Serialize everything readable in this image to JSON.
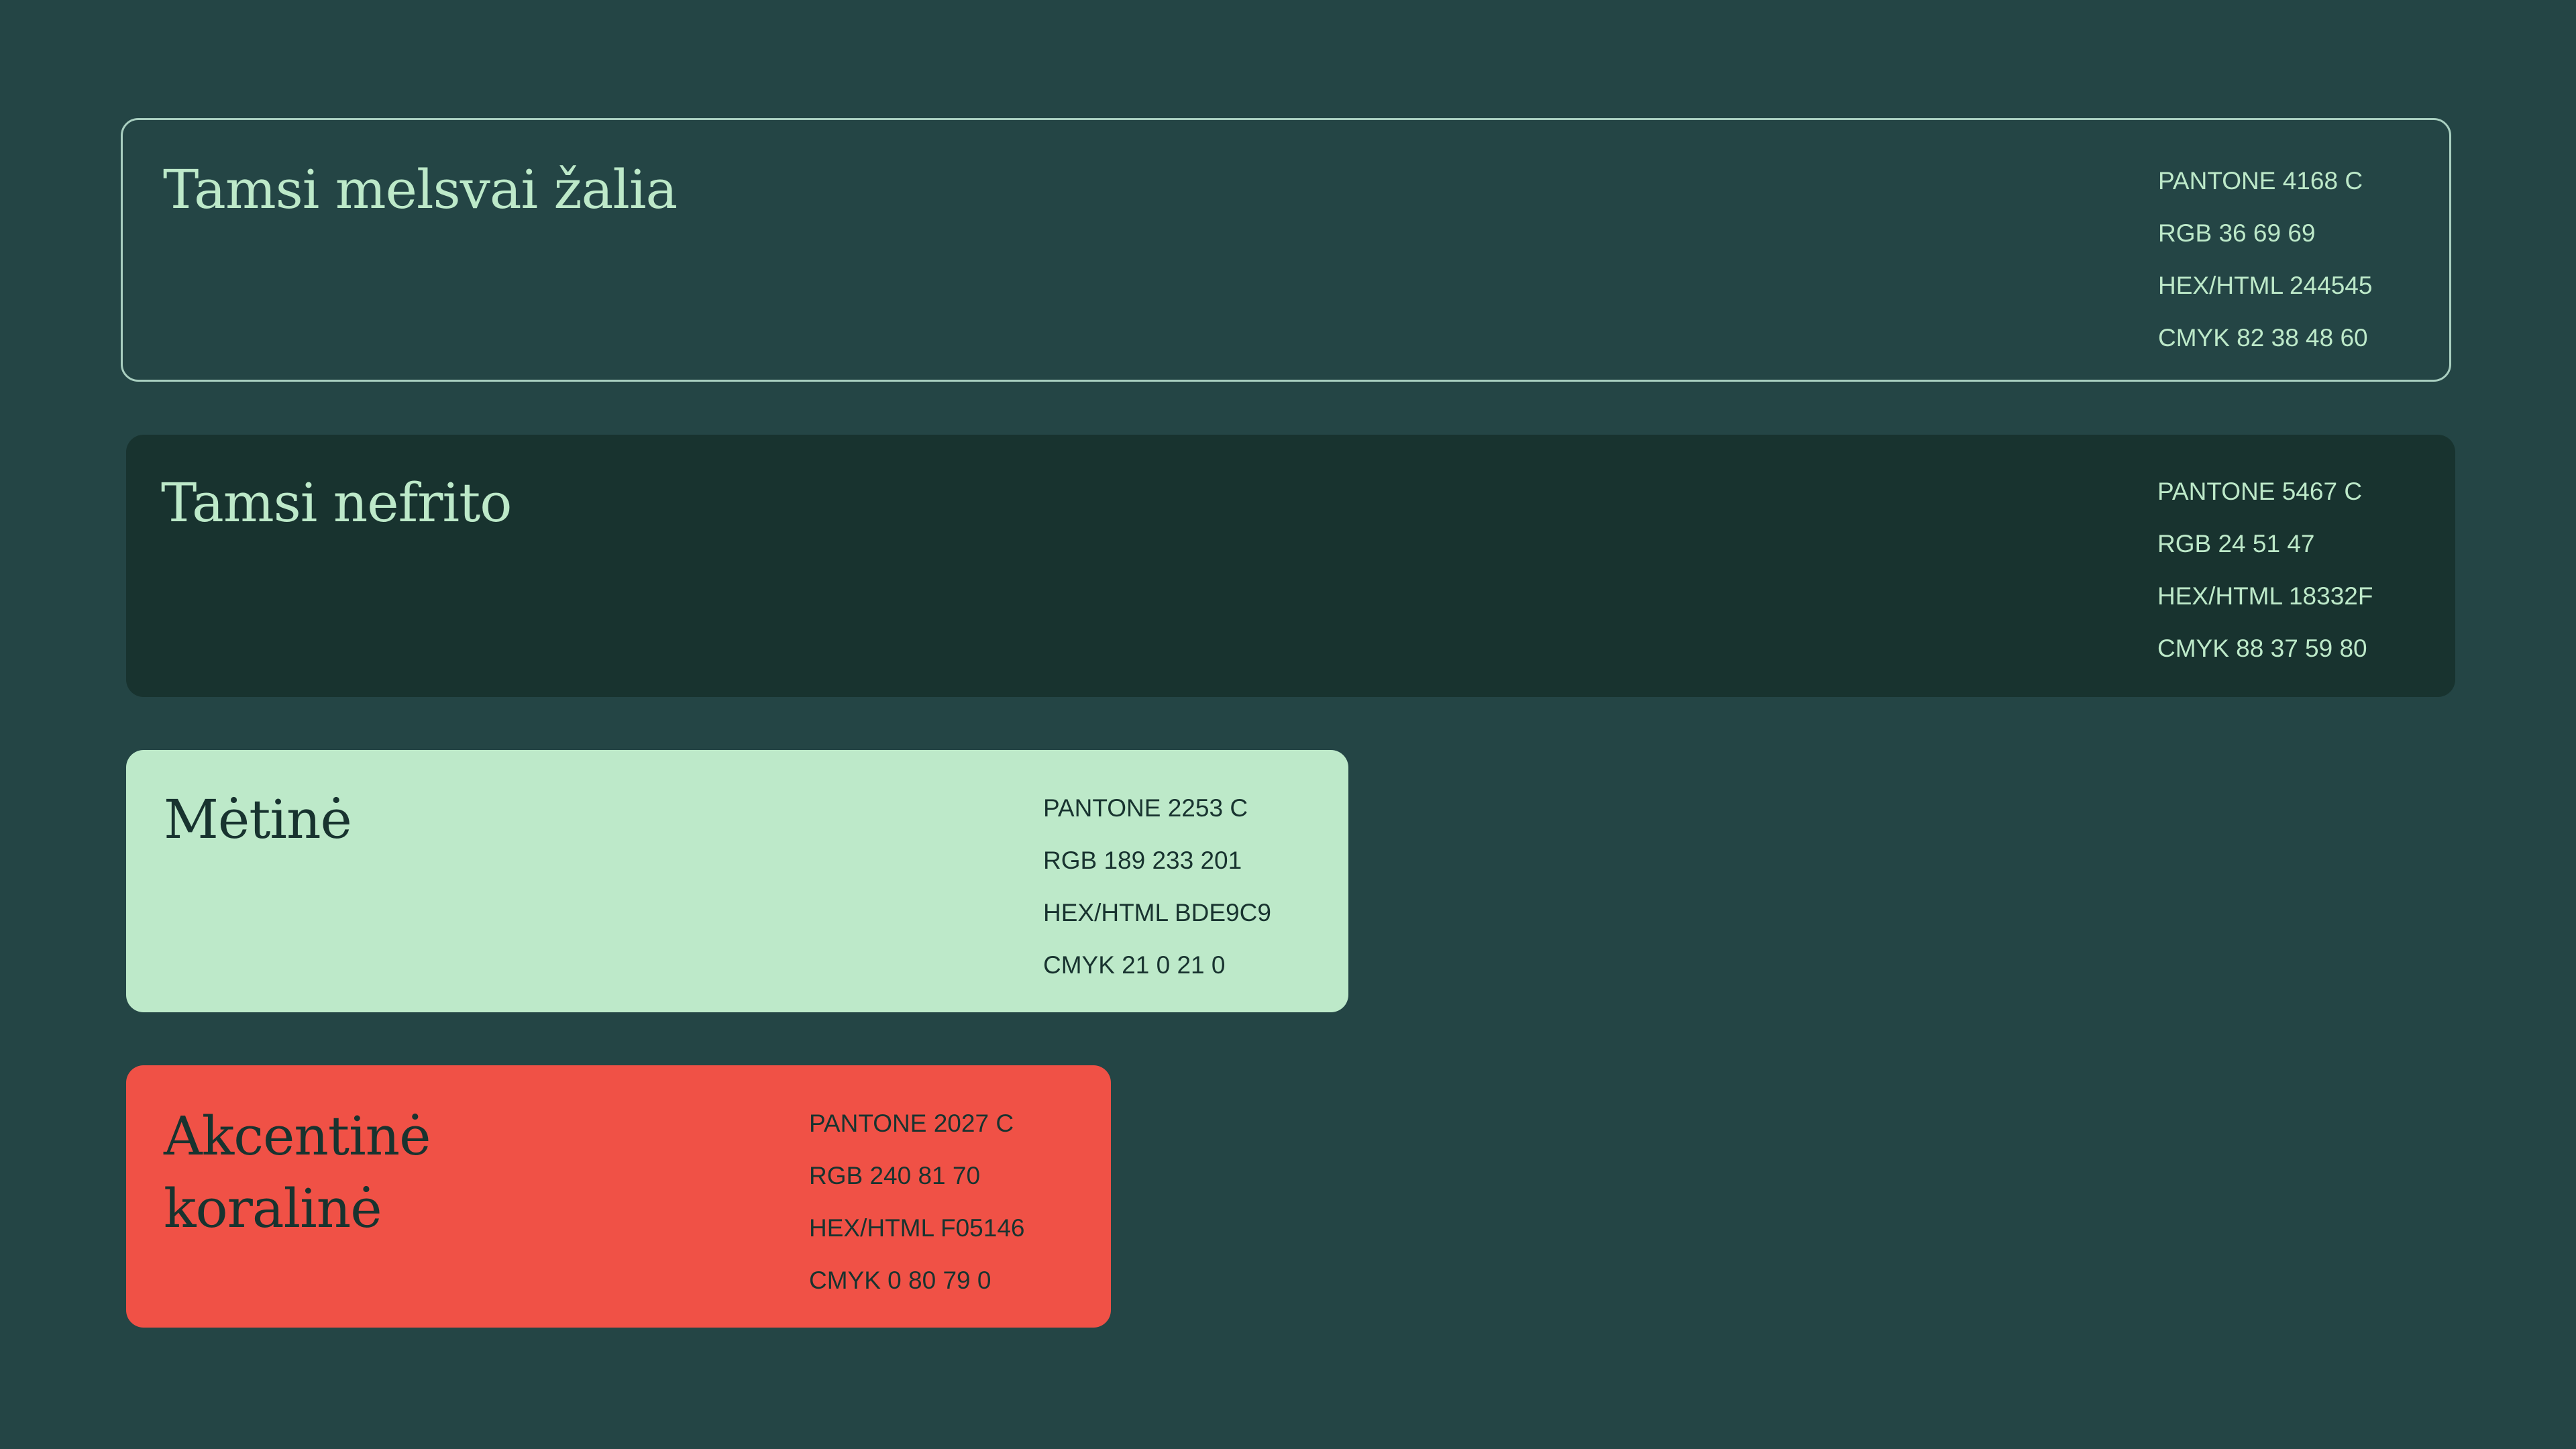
{
  "colors": {
    "page_background": "#244545",
    "outline": "#a9cfc0"
  },
  "swatches": [
    {
      "name": "Tamsi melsvai žalia",
      "fill": "#244545",
      "text_color": "#BDE9C9",
      "pantone": "PANTONE  4168 C",
      "rgb": "RGB 36 69 69",
      "hex": "HEX/HTML 244545",
      "cmyk": "CMYK 82 38 48 60"
    },
    {
      "name": "Tamsi nefrito",
      "fill": "#18332F",
      "text_color": "#BDE9C9",
      "pantone": "PANTONE  5467 C",
      "rgb": "RGB 24 51 47",
      "hex": "HEX/HTML 18332F",
      "cmyk": "CMYK 88 37 59 80"
    },
    {
      "name": "Mėtinė",
      "fill": "#BDE9C9",
      "text_color": "#18332F",
      "pantone": "PANTONE  2253 C",
      "rgb": "RGB 189 233 201",
      "hex": "HEX/HTML BDE9C9",
      "cmyk": "CMYK 21 0 21 0"
    },
    {
      "name": "Akcentinė koralinė",
      "fill": "#F05146",
      "text_color": "#18332F",
      "pantone": "PANTONE  2027 C",
      "rgb": "RGB 240 81 70",
      "hex": "HEX/HTML F05146",
      "cmyk": "CMYK 0 80 79 0"
    }
  ]
}
